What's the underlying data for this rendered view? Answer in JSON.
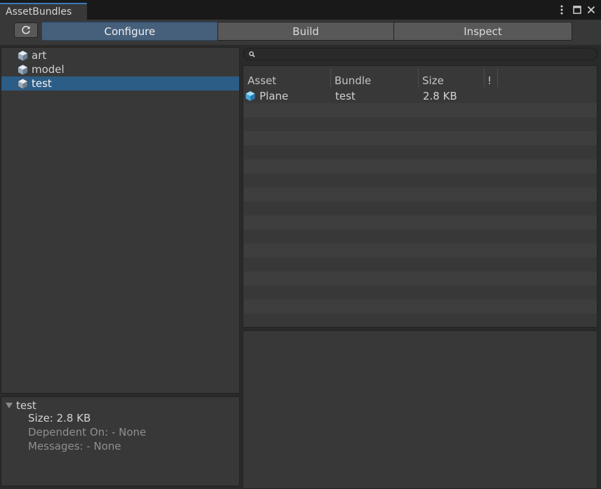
{
  "window": {
    "tab_title": "AssetBundles",
    "menu_icon": "kebab-menu-icon",
    "maximize_icon": "maximize-icon",
    "close_icon": "close-icon"
  },
  "toolbar": {
    "refresh_icon": "refresh-icon",
    "modes": [
      {
        "label": "Configure",
        "active": true
      },
      {
        "label": "Build",
        "active": false
      },
      {
        "label": "Inspect",
        "active": false
      }
    ]
  },
  "bundle_tree": {
    "items": [
      {
        "label": "art",
        "icon": "cube-icon",
        "selected": false
      },
      {
        "label": "model",
        "icon": "cube-icon",
        "selected": false
      },
      {
        "label": "test",
        "icon": "cube-icon",
        "selected": true
      }
    ]
  },
  "bundle_details": {
    "name": "test",
    "size": "Size: 2.8 KB",
    "dependent_on": "Dependent On: - None",
    "messages": "Messages: - None"
  },
  "search": {
    "placeholder": "",
    "value": "",
    "icon": "search-icon"
  },
  "asset_table": {
    "columns": [
      "Asset",
      "Bundle",
      "Size",
      "!"
    ],
    "rows": [
      {
        "asset": "Plane",
        "bundle": "test",
        "size": "2.8 KB",
        "icon": "prefab-cube-icon"
      }
    ]
  },
  "colors": {
    "accent": "#3a79bb",
    "active_tab": "#46607c",
    "selection": "#2c5d87",
    "panel": "#383838",
    "background": "#282828"
  }
}
